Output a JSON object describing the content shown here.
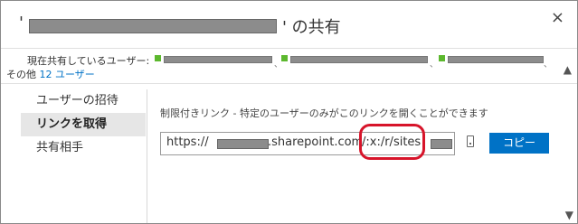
{
  "dialog": {
    "title_open_quote": "'",
    "title_suffix": "' の共有",
    "close_glyph": "×"
  },
  "shared": {
    "label": "現在共有しているユーザー:",
    "more_prefix": "その他",
    "more_link": "12 ユーザー",
    "scroll_up_glyph": "▲",
    "scroll_down_glyph": "▼"
  },
  "nav": {
    "items": [
      {
        "label": "ユーザーの招待"
      },
      {
        "label": "リンクを取得"
      },
      {
        "label": "共有相手"
      }
    ]
  },
  "main": {
    "hint": "制限付きリンク - 特定のユーザーのみがこのリンクを開くことができます",
    "link_https": "https://",
    "link_domain": ".sharepoint.com",
    "link_path": "/:x:/r/sites",
    "copy_label": "コピー"
  },
  "colors": {
    "accent": "#0072c6",
    "highlight": "#d7142a",
    "presence": "#5cb82e"
  }
}
